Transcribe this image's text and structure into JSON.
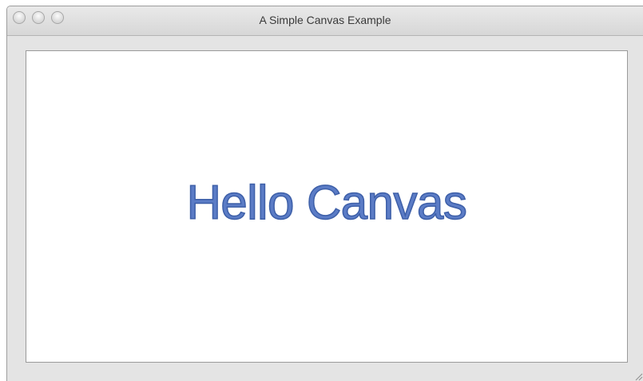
{
  "window": {
    "title": "A Simple Canvas Example",
    "controls": [
      "close-icon",
      "minimize-icon",
      "zoom-icon"
    ],
    "resize_handle_icon": "resize-grip-icon"
  },
  "canvas": {
    "text": "Hello Canvas",
    "text_color": "#5b7cc6",
    "stroke_color": "#3d5fa8",
    "background": "#ffffff"
  },
  "colors": {
    "window_background": "#e4e4e4",
    "title_text": "#3a3a3a"
  }
}
